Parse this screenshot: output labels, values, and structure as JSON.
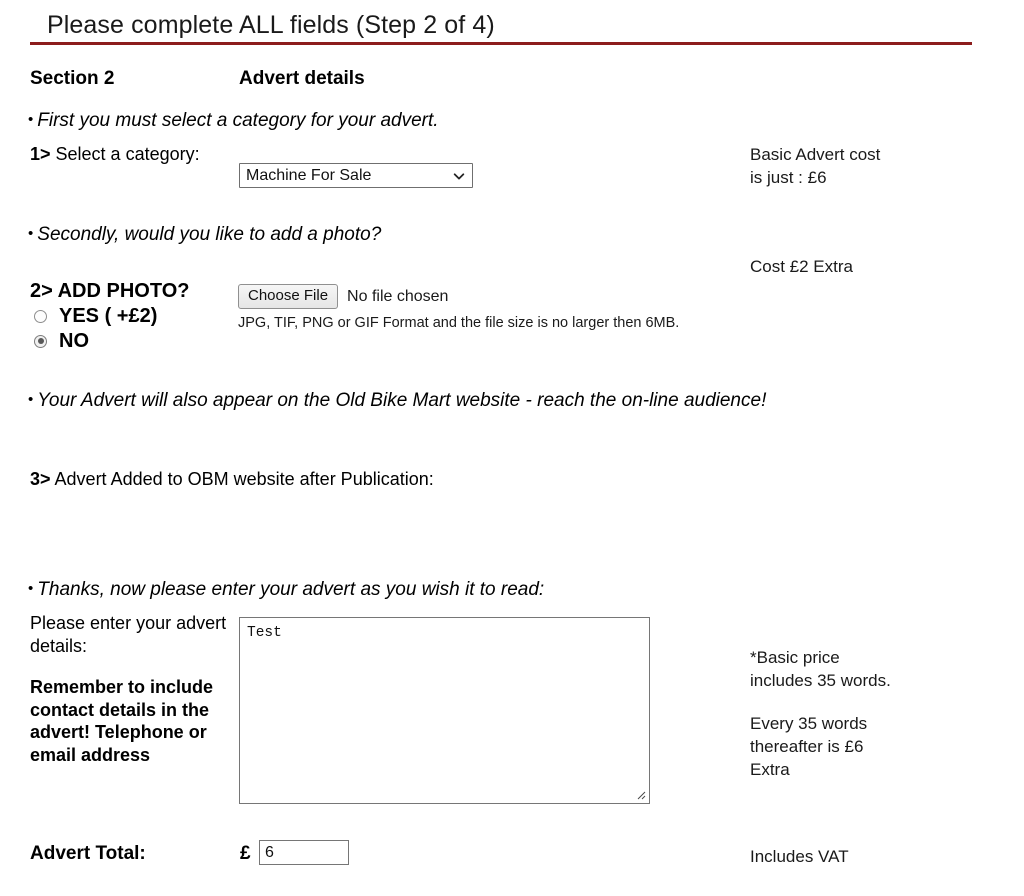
{
  "header": {
    "title": "Please complete ALL fields (Step 2 of 4)",
    "rule_color": "#8c1c1c"
  },
  "section": {
    "label": "Section 2",
    "title": "Advert details"
  },
  "notes": {
    "category": "First you must select a category for your advert.",
    "photo": "Secondly, would you like to add a photo?",
    "website": "Your Advert will also appear on the Old Bike Mart website - reach the on-line audience!",
    "advert_text": "Thanks, now please enter your advert as you wish it to read:",
    "bullet": "•"
  },
  "step1": {
    "number": "1>",
    "label": " Select a category:",
    "select": {
      "value": "Machine For Sale",
      "options": [
        "Machine For Sale"
      ]
    }
  },
  "step2": {
    "label": "2> ADD PHOTO?",
    "options": [
      {
        "label": "YES ( +£2)",
        "checked": false
      },
      {
        "label": "NO",
        "checked": true
      }
    ],
    "file": {
      "button_label": "Choose File",
      "status": "No file chosen",
      "hint": "JPG, TIF, PNG or GIF Format and the file size is no larger then 6MB."
    }
  },
  "step3": {
    "number": "3>",
    "label": " Advert Added to OBM website after Publication:"
  },
  "advert": {
    "label": "Please enter your advert details:",
    "remember": "Remember to include contact details in the advert! Telephone or email address",
    "textarea_value": "Test",
    "textarea_placeholder": ""
  },
  "total": {
    "label": "Advert Total:",
    "currency": "£",
    "value": "6"
  },
  "side_notes": {
    "basic_cost": "Basic Advert cost\nis just : £6",
    "photo_cost": "Cost £2 Extra",
    "words_included": "*Basic price\nincludes 35 words.",
    "words_extra": "Every 35 words\nthereafter is £6\nExtra",
    "vat": "Includes VAT"
  },
  "icons": {
    "chevron_down": "chevron-down-icon",
    "resize_grip": "resize-grip-icon"
  }
}
